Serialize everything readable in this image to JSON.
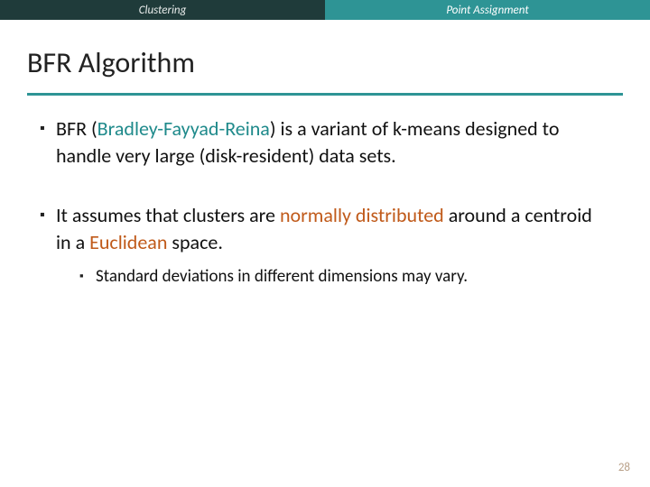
{
  "topbar": {
    "left": "Clustering",
    "right": "Point Assignment"
  },
  "title": "BFR Algorithm",
  "bullets": [
    {
      "pre": "BFR (",
      "hl1": "Bradley-Fayyad-Reina",
      "post": ") is a variant of k-means designed to handle very large (disk-resident) data sets."
    },
    {
      "pre": "It assumes that clusters are ",
      "hl2": "normally distributed",
      "mid": " around a centroid in a ",
      "hl3": "Euclidean",
      "post2": " space.",
      "sub": "Standard deviations in different dimensions may vary."
    }
  ],
  "page": "28"
}
